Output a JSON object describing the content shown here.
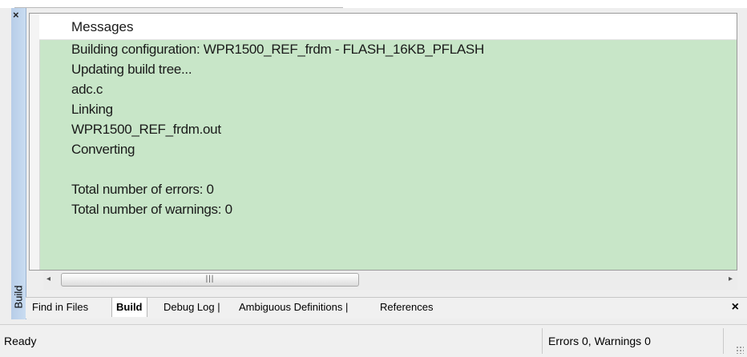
{
  "panel": {
    "side_title": "Build",
    "close_symbol": "×",
    "header": "Messages",
    "messages": [
      "Building configuration: WPR1500_REF_frdm - FLASH_16KB_PFLASH",
      "Updating build tree...",
      "adc.c",
      "Linking",
      "WPR1500_REF_frdm.out",
      "Converting",
      "",
      "Total number of errors: 0",
      "Total number of warnings: 0"
    ],
    "background_color": "#c8e6c8"
  },
  "scrollbar": {
    "left_arrow": "◂",
    "right_arrow": "▸",
    "grip": "|||"
  },
  "tabs": {
    "items": [
      "Find in Files",
      "Build",
      "Debug Log |",
      "Ambiguous Definitions |",
      "References"
    ],
    "active": "Build",
    "close_symbol": "×"
  },
  "status": {
    "left": "Ready",
    "right": "Errors 0, Warnings 0"
  }
}
